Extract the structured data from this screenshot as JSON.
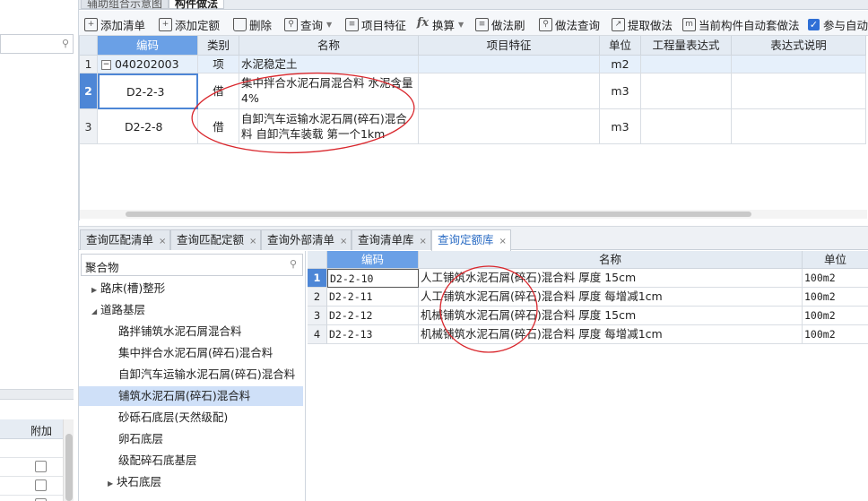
{
  "colors": {
    "accent": "#4d86d6",
    "header_selected": "#6aa0e6",
    "annotation": "#d9262c"
  },
  "top_tabs": [
    "辅助组合示意图",
    "构件做法"
  ],
  "toolbar": {
    "add_list": "添加清单",
    "add_quota": "添加定额",
    "delete": "删除",
    "query": "查询",
    "item_feature": "项目特征",
    "convert": "换算",
    "method_brush": "做法刷",
    "method_query": "做法查询",
    "extract_method": "提取做法",
    "auto_apply": "当前构件自动套做法",
    "participate": "参与自动套"
  },
  "grid1": {
    "headers": {
      "code": "编码",
      "type": "类别",
      "name": "名称",
      "feature": "项目特征",
      "unit": "单位",
      "expr": "工程量表达式",
      "desc": "表达式说明"
    },
    "rows": [
      {
        "num": "1",
        "code": "040202003",
        "type": "项",
        "name": "水泥稳定土",
        "unit": "m2"
      },
      {
        "num": "2",
        "code": "D2-2-3",
        "type": "借",
        "name": "集中拌合水泥石屑混合料 水泥含量4%",
        "unit": "m3"
      },
      {
        "num": "3",
        "code": "D2-2-8",
        "type": "借",
        "name": "自卸汽车运输水泥石屑(碎石)混合料 自卸汽车装载 第一个1km",
        "unit": "m3"
      }
    ]
  },
  "bottom_tabs": [
    "查询匹配清单",
    "查询匹配定额",
    "查询外部清单",
    "查询清单库",
    "查询定额库"
  ],
  "tree": {
    "search_value": "聚合物",
    "items": [
      {
        "label": "路床(槽)整形",
        "level": 1,
        "arrow": "▶"
      },
      {
        "label": "道路基层",
        "level": 1,
        "arrow": "◢"
      },
      {
        "label": "路拌铺筑水泥石屑混合料",
        "level": 2,
        "arrow": ""
      },
      {
        "label": "集中拌合水泥石屑(碎石)混合料",
        "level": 2,
        "arrow": ""
      },
      {
        "label": "自卸汽车运输水泥石屑(碎石)混合料",
        "level": 2,
        "arrow": ""
      },
      {
        "label": "铺筑水泥石屑(碎石)混合料",
        "level": 2,
        "arrow": ""
      },
      {
        "label": "砂砾石底层(天然级配)",
        "level": 2,
        "arrow": ""
      },
      {
        "label": "卵石底层",
        "level": 2,
        "arrow": ""
      },
      {
        "label": "级配碎石底基层",
        "level": 2,
        "arrow": ""
      },
      {
        "label": "块石底层",
        "level": 1,
        "arrow": "▶"
      }
    ]
  },
  "grid2": {
    "headers": {
      "code": "编码",
      "name": "名称",
      "unit": "单位"
    },
    "rows": [
      {
        "num": "1",
        "code": "D2-2-10",
        "name": "人工铺筑水泥石屑(碎石)混合料 厚度 15cm",
        "unit": "100m2"
      },
      {
        "num": "2",
        "code": "D2-2-11",
        "name": "人工铺筑水泥石屑(碎石)混合料 厚度 每增减1cm",
        "unit": "100m2"
      },
      {
        "num": "3",
        "code": "D2-2-12",
        "name": "机械铺筑水泥石屑(碎石)混合料 厚度 15cm",
        "unit": "100m2"
      },
      {
        "num": "4",
        "code": "D2-2-13",
        "name": "机械铺筑水泥石屑(碎石)混合料 厚度 每增减1cm",
        "unit": "100m2"
      }
    ]
  },
  "left": {
    "col_header": "附加"
  }
}
